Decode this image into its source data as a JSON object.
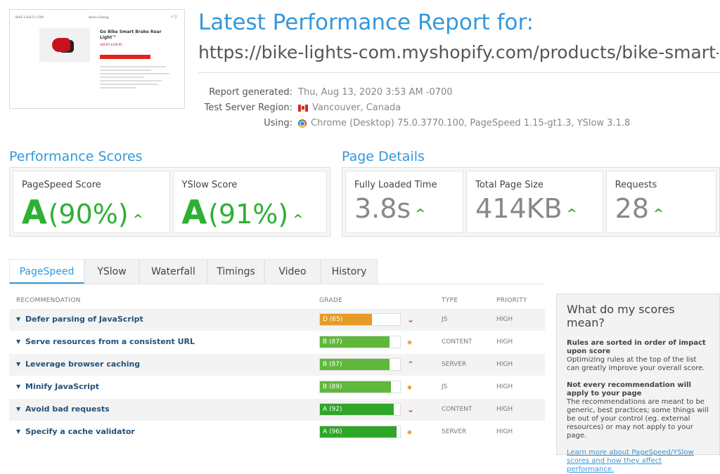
{
  "header": {
    "title": "Latest Performance Report for:",
    "url": "https://bike-lights-com.myshopify.com/products/bike-smart-...",
    "meta": [
      {
        "label": "Report generated:",
        "value": "Thu, Aug 13, 2020 3:53 AM -0700",
        "icon": ""
      },
      {
        "label": "Test Server Region:",
        "value": "Vancouver, Canada",
        "icon": "canada-flag-icon"
      },
      {
        "label": "Using:",
        "value": "Chrome (Desktop) 75.0.3770.100, PageSpeed 1.15-gt1.3, YSlow 3.1.8",
        "icon": "chrome-icon"
      }
    ]
  },
  "thumbnail": {
    "site_name": "BIKE-LIGHTS.COM",
    "nav": "Home   Catalog",
    "product_title": "Go Bike Smart Brake Rear Light™",
    "price": "$59.95 $139.95"
  },
  "performance": {
    "title": "Performance Scores",
    "pagespeed": {
      "label": "PageSpeed Score",
      "grade": "A",
      "pct": "(90%)"
    },
    "yslow": {
      "label": "YSlow Score",
      "grade": "A",
      "pct": "(91%)"
    }
  },
  "details": {
    "title": "Page Details",
    "loaded": {
      "label": "Fully Loaded Time",
      "value": "3.8s"
    },
    "size": {
      "label": "Total Page Size",
      "value": "414KB"
    },
    "requests": {
      "label": "Requests",
      "value": "28"
    }
  },
  "tabs": [
    "PageSpeed",
    "YSlow",
    "Waterfall",
    "Timings",
    "Video",
    "History"
  ],
  "table": {
    "headers": {
      "recommendation": "RECOMMENDATION",
      "grade": "GRADE",
      "type": "TYPE",
      "priority": "PRIORITY"
    },
    "rows": [
      {
        "rec": "Defer parsing of JavaScript",
        "grade": "D (65)",
        "score": 0.65,
        "color": "#e59b25",
        "trend": "down",
        "type": "JS",
        "priority": "HIGH"
      },
      {
        "rec": "Serve resources from a consistent URL",
        "grade": "B (87)",
        "score": 0.87,
        "color": "#5fb73b",
        "trend": "same",
        "type": "CONTENT",
        "priority": "HIGH"
      },
      {
        "rec": "Leverage browser caching",
        "grade": "B (87)",
        "score": 0.87,
        "color": "#5fb73b",
        "trend": "up",
        "type": "SERVER",
        "priority": "HIGH"
      },
      {
        "rec": "Minify JavaScript",
        "grade": "B (89)",
        "score": 0.89,
        "color": "#5fb73b",
        "trend": "same",
        "type": "JS",
        "priority": "HIGH"
      },
      {
        "rec": "Avoid bad requests",
        "grade": "A (92)",
        "score": 0.92,
        "color": "#2fa629",
        "trend": "down",
        "type": "CONTENT",
        "priority": "HIGH"
      },
      {
        "rec": "Specify a cache validator",
        "grade": "A (96)",
        "score": 0.96,
        "color": "#2fa629",
        "trend": "same",
        "type": "SERVER",
        "priority": "HIGH"
      }
    ]
  },
  "sidebar": {
    "title": "What do my scores mean?",
    "b1": "Rules are sorted in order of impact upon score",
    "t1": "Optimizing rules at the top of the list can greatly improve your overall score.",
    "b2": "Not every recommendation will apply to your page",
    "t2": "The recommendations are meant to be generic, best practices; some things will be out of your control (eg. external resources) or may not apply to your page.",
    "link": "Learn more about PageSpeed/YSlow scores and how they affect performance."
  },
  "colors": {
    "accent": "#3498db",
    "good": "#2fb034",
    "warn": "#f0a030",
    "bad": "#d9304c"
  }
}
